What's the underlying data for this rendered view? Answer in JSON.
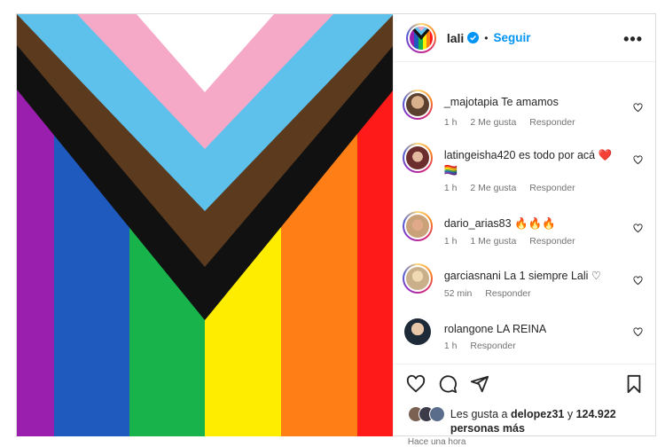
{
  "header": {
    "username": "lali",
    "separator": "•",
    "follow_label": "Seguir",
    "more_label": "•••"
  },
  "comments": [
    {
      "user": "_majotapia",
      "text": "Te amamos",
      "time": "1 h",
      "likes": "2 Me gusta",
      "reply": "Responder"
    },
    {
      "user": "latingeisha420",
      "text": "es todo por acá ❤️ 🏳️‍🌈",
      "time": "1 h",
      "likes": "2 Me gusta",
      "reply": "Responder"
    },
    {
      "user": "dario_arias83",
      "text": "🔥🔥🔥",
      "time": "1 h",
      "likes": "1 Me gusta",
      "reply": "Responder"
    },
    {
      "user": "garciasnani",
      "text": "La 1 siempre Lali ♡",
      "time": "52 min",
      "likes": "",
      "reply": "Responder"
    },
    {
      "user": "rolangone",
      "text": "LA REINA",
      "time": "1 h",
      "likes": "",
      "reply": "Responder"
    }
  ],
  "likes": {
    "prefix": "Les gusta a ",
    "user": "delopez31",
    "middle": " y ",
    "count": "124.922",
    "suffix": "personas más"
  },
  "timestamp": "Hace una hora",
  "colors": {
    "accent": "#0095f6",
    "flag_red": "#ff1a1a",
    "flag_orange": "#ff7f16",
    "flag_yellow": "#ffed00",
    "flag_green": "#18b34b",
    "flag_blue": "#1f5bbf",
    "flag_purple": "#9b1faf",
    "flag_pink": "#f5a9c6",
    "flag_light_blue": "#5ec1ec",
    "flag_brown": "#5b3a1e",
    "flag_black": "#111111"
  },
  "icons": [
    "verified-icon",
    "more-icon",
    "heart-icon",
    "comment-icon",
    "share-icon",
    "bookmark-icon"
  ]
}
